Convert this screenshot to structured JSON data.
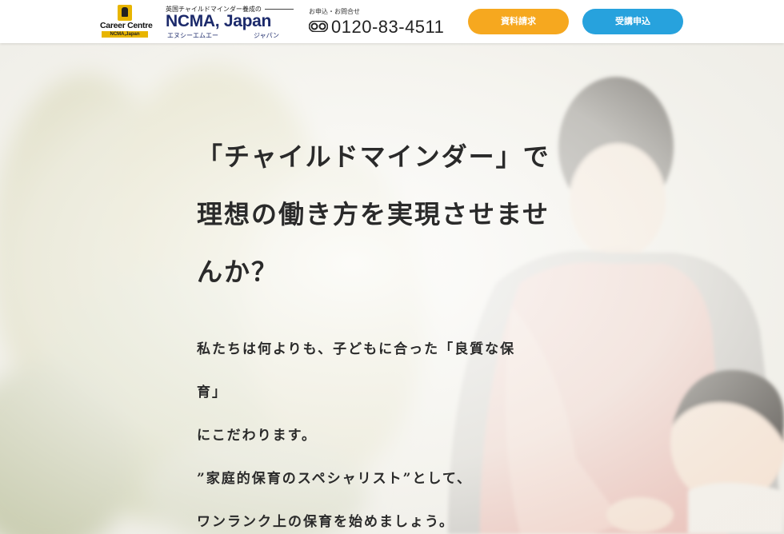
{
  "header": {
    "career_logo": {
      "title": "Career Centre",
      "sub": "NCMA,Japan"
    },
    "ncma_logo": {
      "tagline": "英国チャイルドマインダー養成の",
      "name": "NCMA, Japan",
      "kana_left": "エヌシーエムエー",
      "kana_right": "ジャパン"
    },
    "phone": {
      "label": "お申込・お問合せ",
      "icon": "free-dial-icon",
      "number": "0120-83-4511"
    },
    "buttons": {
      "request": "資料請求",
      "apply": "受講申込"
    },
    "colors": {
      "orange": "#f6a81f",
      "blue": "#27a2dd",
      "navy": "#1c2a6b"
    }
  },
  "hero": {
    "headline": [
      "「チャイルドマインダー」で",
      "理想の働き方を実現させませ",
      "んか？"
    ],
    "body": [
      "私たちは何よりも、子どもに合った「良質な保",
      "育」",
      "にこだわります。",
      "”家庭的保育のスペシャリスト”として、",
      "ワンランク上の保育を始めましょう。"
    ]
  }
}
